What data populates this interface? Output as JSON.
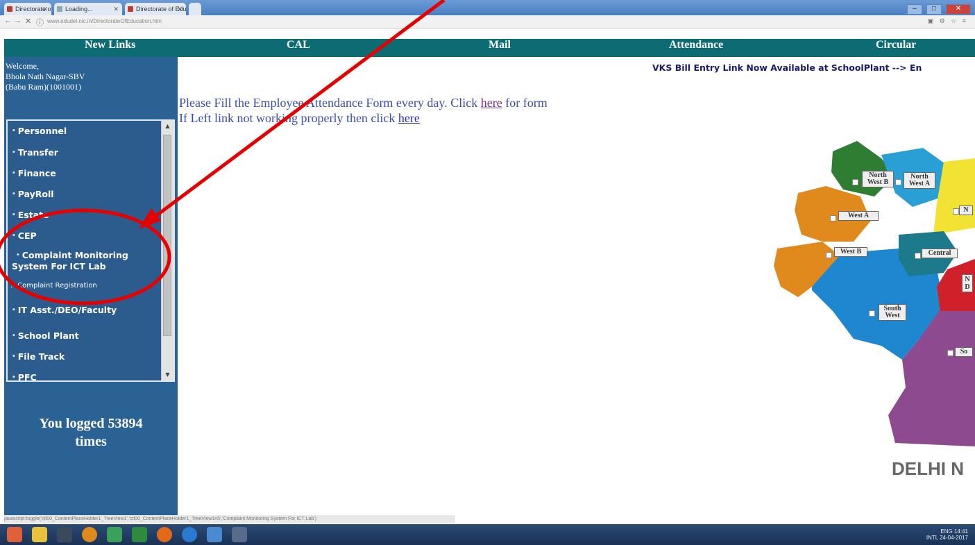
{
  "browser": {
    "tabs": [
      {
        "title": "Directorate of Education"
      },
      {
        "title": "Loading..."
      },
      {
        "title": "Directorate of Education"
      }
    ],
    "url": "www.edudel.nic.in/DirectorateOfEducation.htm",
    "nav": {
      "back": "←",
      "forward": "→",
      "stop": "✕",
      "info": "ⓘ"
    },
    "window_controls": {
      "minimize": "–",
      "maximize": "□",
      "close": "✕"
    }
  },
  "topnav": {
    "items": [
      "New Links",
      "CAL",
      "Mail",
      "Attendance",
      "Circular"
    ]
  },
  "sidebar": {
    "welcome_line1": "Welcome,",
    "welcome_line2": "Bhola Nath Nagar-SBV",
    "welcome_line3": "(Babu Ram)(1001001)",
    "menu": [
      "Personnel",
      "Transfer",
      "Finance",
      "PayRoll",
      "Estate",
      "CEP",
      "Complaint Monitoring",
      "System For ICT Lab",
      "IT Asst./DEO/Faculty",
      "School Plant",
      "File Track",
      "PFC"
    ],
    "submenu_item": ":- Complaint Registration",
    "bullet": "•",
    "scroll_up": "▲",
    "scroll_down": "▼",
    "login_line1": "You logged 53894",
    "login_line2": "times"
  },
  "main": {
    "marquee": "VKS Bill Entry Link Now Available at SchoolPlant --> En",
    "notice1_text": "Please Fill the Employee Attendance Form every day. Click",
    "notice1_link": "here",
    "notice1_tail": "for form",
    "notice2_text": "If Left link not working properly then click",
    "notice2_link": "here"
  },
  "map": {
    "title": "DELHI N",
    "districts": [
      "North West B",
      "North West A",
      "N",
      "West A",
      "West B",
      "Central",
      "N D",
      "South West",
      "So"
    ],
    "colors": {
      "north_west_b": "#2e7d32",
      "north_west_a": "#2a9fd6",
      "north": "#f2e233",
      "west_a": "#e08a1e",
      "west_b": "#e08a1e",
      "central": "#1d7a8a",
      "new_delhi": "#d0202a",
      "south_west": "#1f86d0",
      "south": "#8e4a8e"
    }
  },
  "statusbar": {
    "text": "javascript:toggle('ctl00_ContentPlaceHolder1_TreeView1','ctl00_ContentPlaceHolder1_TreeView1n5','Complaint Monitoring System For ICT Lab')"
  },
  "taskbar": {
    "tray_line1": "ENG  14:41",
    "tray_line2": "INTL  24-04-2017"
  },
  "annotation": {
    "color": "#e60000"
  }
}
